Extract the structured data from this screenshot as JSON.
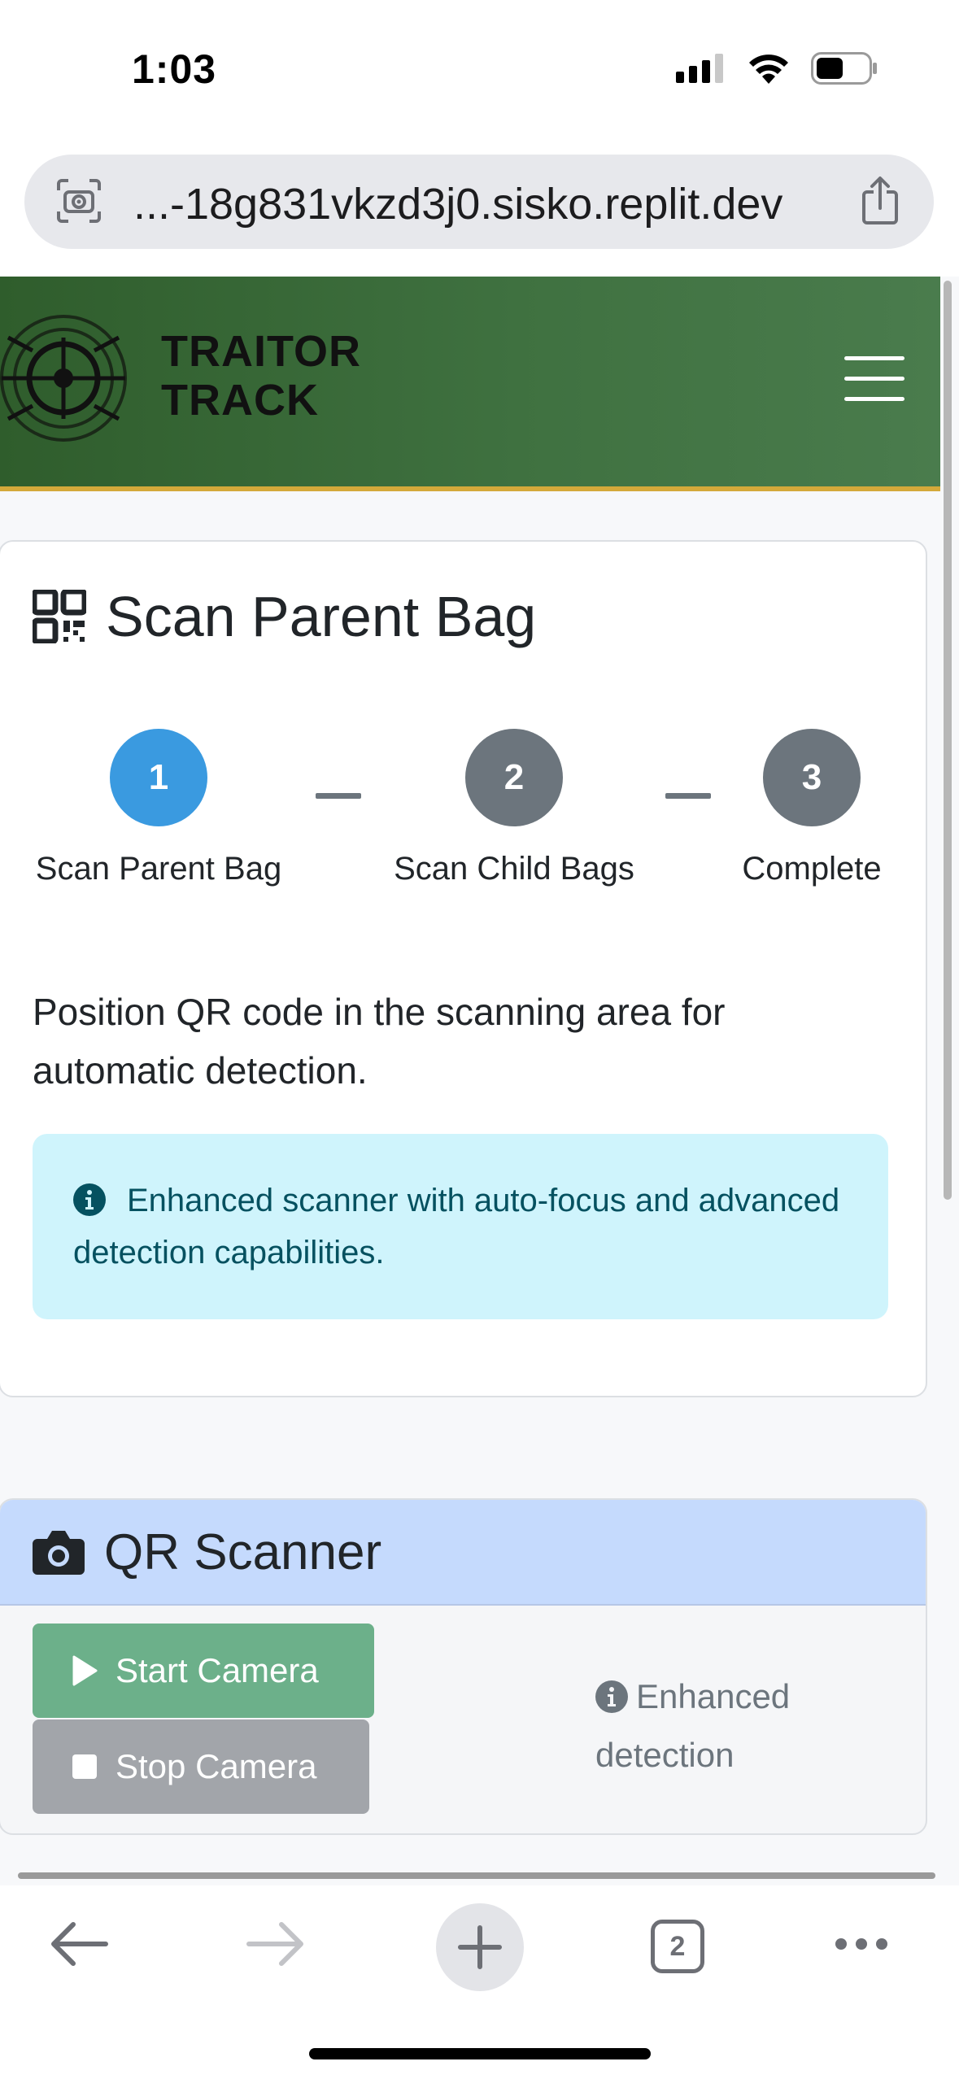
{
  "status_bar": {
    "time": "1:03"
  },
  "browser": {
    "url": "...-18g831vkzd3j0.sisko.replit.dev",
    "tab_count": "2"
  },
  "header": {
    "brand_line1": "TRAITOR",
    "brand_line2": "TRACK"
  },
  "scan_card": {
    "title": "Scan Parent Bag",
    "steps": [
      {
        "number": "1",
        "label": "Scan Parent Bag"
      },
      {
        "number": "2",
        "label": "Scan Child Bags"
      },
      {
        "number": "3",
        "label": "Complete"
      }
    ],
    "instruction": "Position QR code in the scanning area for automatic detection.",
    "info_alert": "Enhanced scanner with auto-focus and advanced detection capabilities."
  },
  "scanner_card": {
    "title": "QR Scanner",
    "start_button": "Start Camera",
    "stop_button": "Stop Camera",
    "enhanced_note": "Enhanced detection"
  },
  "colors": {
    "header_green": "#3f7140",
    "header_accent": "#d4a93a",
    "step_active": "#3a9ae0",
    "step_inactive": "#6c757d",
    "info_bg": "#cff4fc",
    "info_text": "#055160",
    "scanner_header_bg": "#c5dafd",
    "start_button": "#6cb08a",
    "stop_button": "#a2a5aa"
  },
  "icons": {
    "status": [
      "cellular-signal-icon",
      "wifi-icon",
      "battery-icon"
    ],
    "address": [
      "camera-search-icon",
      "share-icon"
    ],
    "header": [
      "target-logo-icon",
      "hamburger-menu-icon"
    ],
    "card": [
      "qrcode-icon",
      "info-circle-icon",
      "camera-icon",
      "play-icon",
      "stop-icon"
    ],
    "toolbar": [
      "back-arrow-icon",
      "forward-arrow-icon",
      "plus-icon",
      "tabs-icon",
      "more-icon"
    ]
  }
}
